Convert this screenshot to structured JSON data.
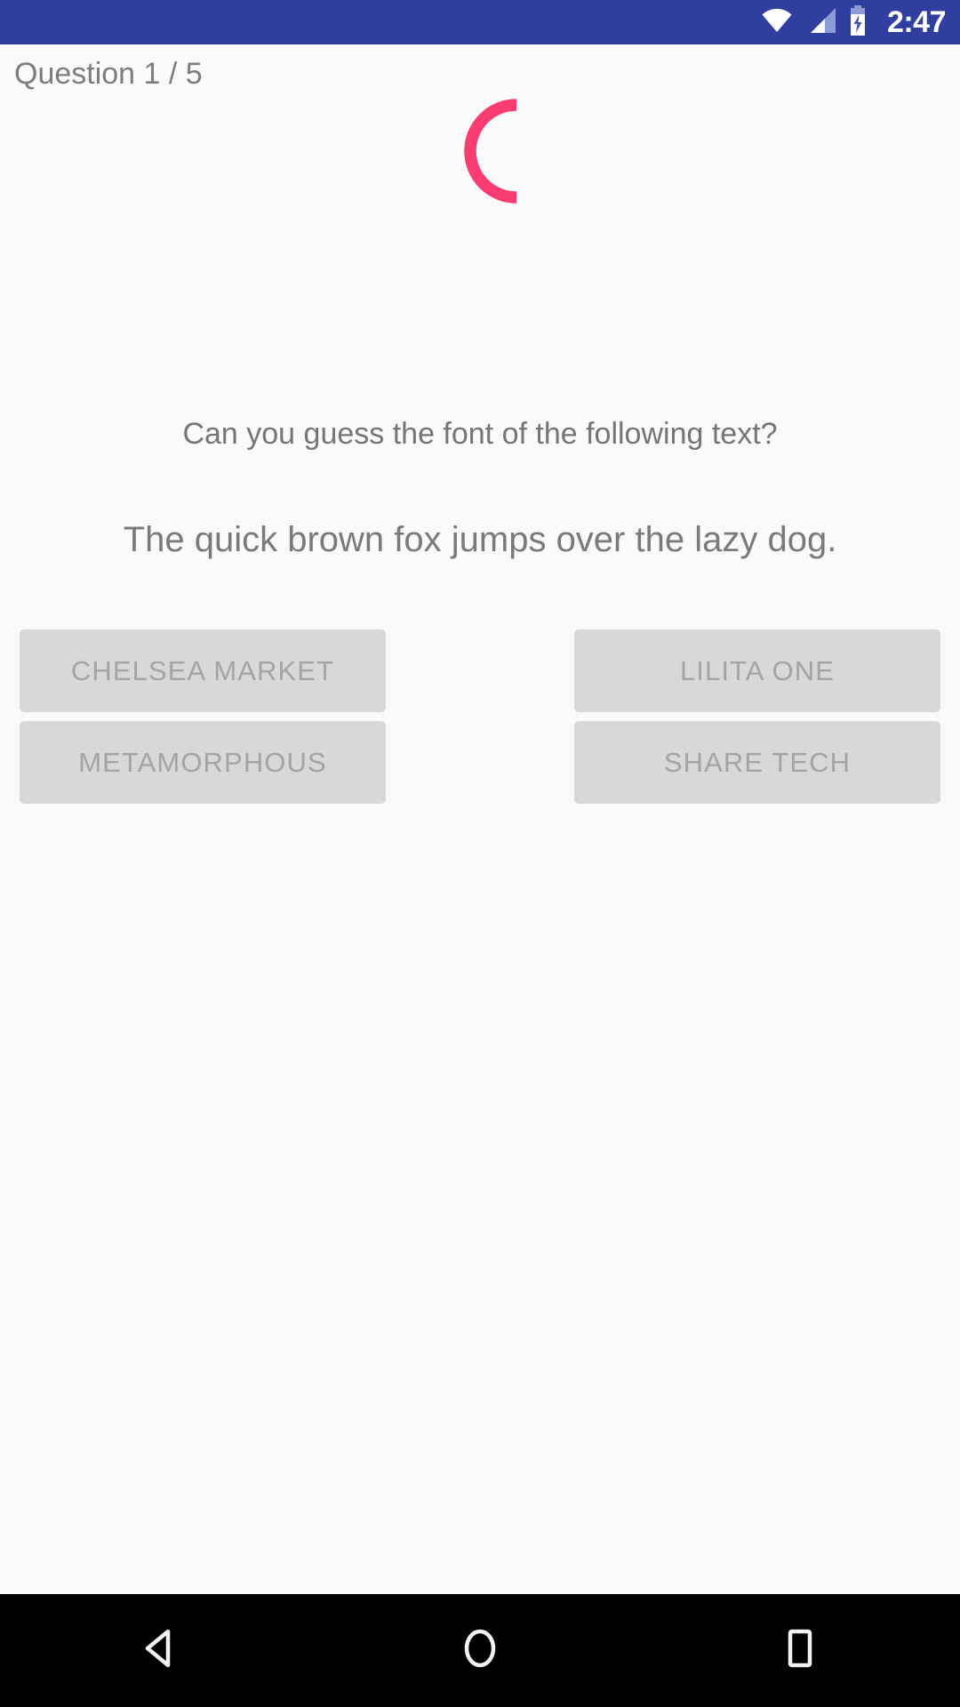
{
  "status_bar": {
    "background_color": "#303f9f",
    "clock": "2:47",
    "icons": [
      {
        "name": "wifi-icon",
        "label": "WiFi signal full"
      },
      {
        "name": "cellular-signal-icon",
        "label": "Cellular signal"
      },
      {
        "name": "battery-charging-icon",
        "label": "Battery charging"
      }
    ]
  },
  "quiz": {
    "counter_label": "Question 1 / 5",
    "prompt": "Can you guess the font of the following text?",
    "sample_text": "The quick brown fox jumps over the lazy dog.",
    "spinner": {
      "name": "loading-spinner",
      "color": "#f93d72"
    },
    "answers": [
      {
        "label": "CHELSEA MARKET"
      },
      {
        "label": "LILITA ONE"
      },
      {
        "label": "METAMORPHOUS"
      },
      {
        "label": "SHARE TECH"
      }
    ],
    "answer_background_color": "#d7d8d8",
    "answer_text_color": "#a3a4a4"
  },
  "nav_bar": {
    "background_color": "#000000",
    "buttons": [
      {
        "name": "back-button",
        "label": "Back"
      },
      {
        "name": "home-button",
        "label": "Home"
      },
      {
        "name": "recents-button",
        "label": "Recent apps"
      }
    ]
  }
}
